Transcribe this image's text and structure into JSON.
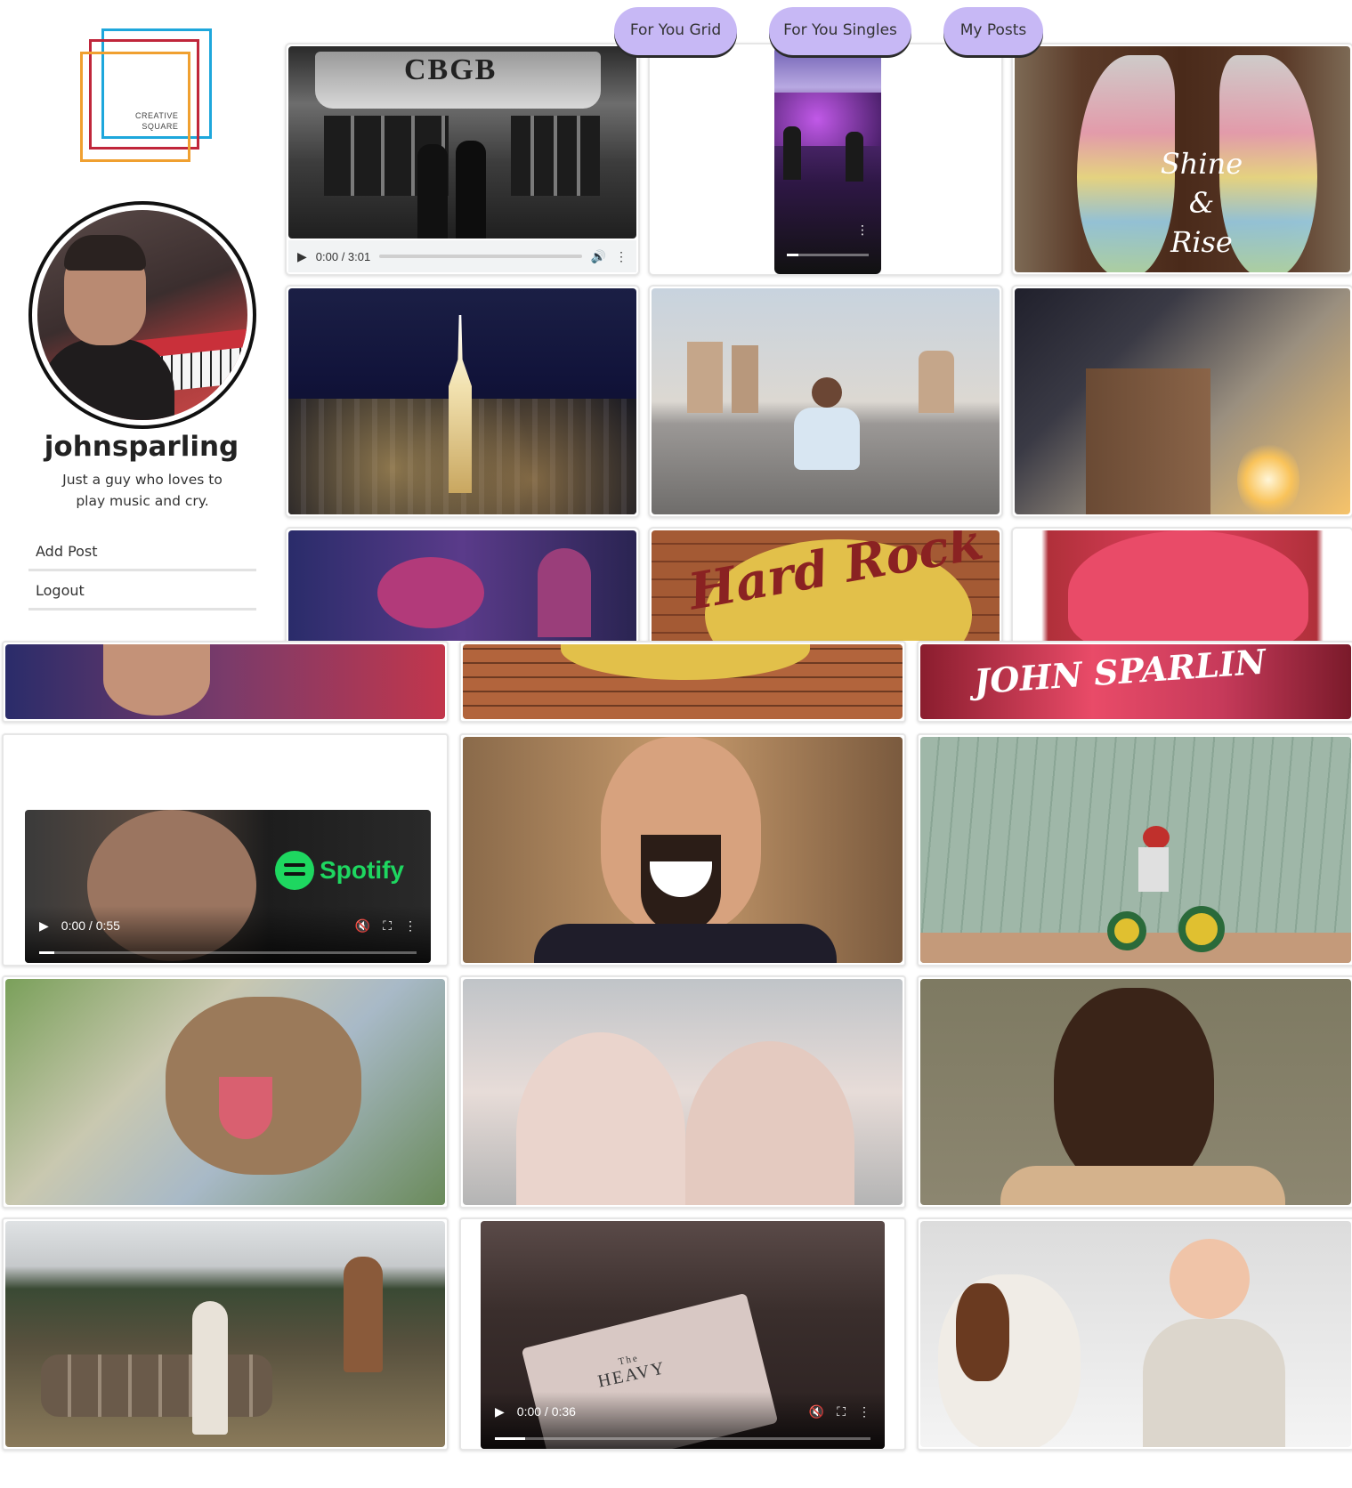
{
  "brand": {
    "logo_line1": "CREATIVE",
    "logo_line2": "SQUARE",
    "colors": [
      "#1ea7dc",
      "#c0263b",
      "#f0a030"
    ]
  },
  "profile": {
    "username": "johnsparling",
    "bio": "Just a guy who loves to play music and cry."
  },
  "sidebar": {
    "links": [
      {
        "label": "Add Post"
      },
      {
        "label": "Logout"
      }
    ]
  },
  "tabs": [
    {
      "label": "For You Grid"
    },
    {
      "label": "For You Singles"
    },
    {
      "label": "My Posts"
    }
  ],
  "accent_color": "#c7b8f5",
  "posts": {
    "cbgb": {
      "type": "audio",
      "time": "0:00 / 3:01",
      "sign_text": "CBGB"
    },
    "concert_video": {
      "type": "video"
    },
    "wings": {
      "type": "image",
      "text": [
        "Shine",
        "&",
        "Rise"
      ]
    },
    "spotify_video": {
      "type": "video",
      "time": "0:00 / 0:55",
      "badge": "Spotify"
    },
    "heavy_video": {
      "type": "video",
      "time": "0:00 / 0:36",
      "text_small": "The",
      "text": "HEAVY"
    },
    "hardrock": {
      "type": "image",
      "text": "Hard Rock"
    },
    "pink": {
      "type": "image",
      "text": "JOHN SPARLIN"
    }
  }
}
